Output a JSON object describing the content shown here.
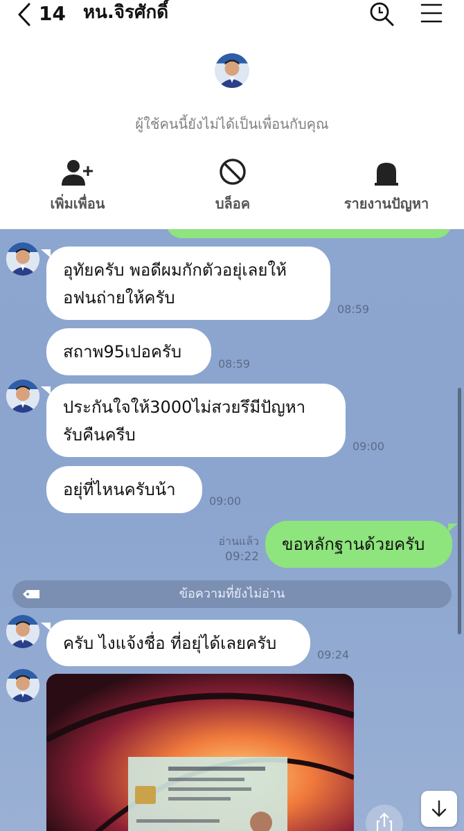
{
  "header": {
    "unread_count": "14",
    "title": "หน.จิรศักดิ์",
    "search_icon": "search-icon",
    "menu_icon": "menu-icon"
  },
  "profile": {
    "notice": "ผู้ใช้คนนี้ยังไม่ได้เป็นเพื่อนกับคุณ",
    "actions": [
      {
        "label": "เพิ่มเพื่อน",
        "icon": "add-friend-icon"
      },
      {
        "label": "บล็อค",
        "icon": "block-icon"
      },
      {
        "label": "รายงานปัญหา",
        "icon": "report-icon"
      }
    ]
  },
  "messages": [
    {
      "from": "them",
      "text": "อุทัยครับ พอดีผมกักตัวอยุ่เลยให้\nอฟนถ่ายให้ครับ",
      "time": "08:59"
    },
    {
      "from": "them",
      "text": "สถาพ95เปอครับ",
      "time": "08:59"
    },
    {
      "from": "them",
      "text": "ประกันใจให้3000ไม่สวยรึมีปัญหา\nรับคืนครีบ",
      "time": "09:00"
    },
    {
      "from": "them",
      "text": "อยุ่ที่ไหนครับน้า",
      "time": "09:00"
    },
    {
      "from": "me",
      "text": "ขอหลักฐานด้วยครับ",
      "time": "09:22",
      "status": "อ่านแล้ว"
    },
    {
      "from": "them",
      "text": "ครับ ไงแจ้งชื่อ ที่อยุ่ได้เลยครับ",
      "time": "09:24"
    }
  ],
  "unread_divider": "ข้อความที่ยังไม่อ่าน",
  "colors": {
    "chat_background": "#8ea6cc",
    "outgoing_bubble": "#8ee47d",
    "incoming_bubble": "#ffffff"
  }
}
